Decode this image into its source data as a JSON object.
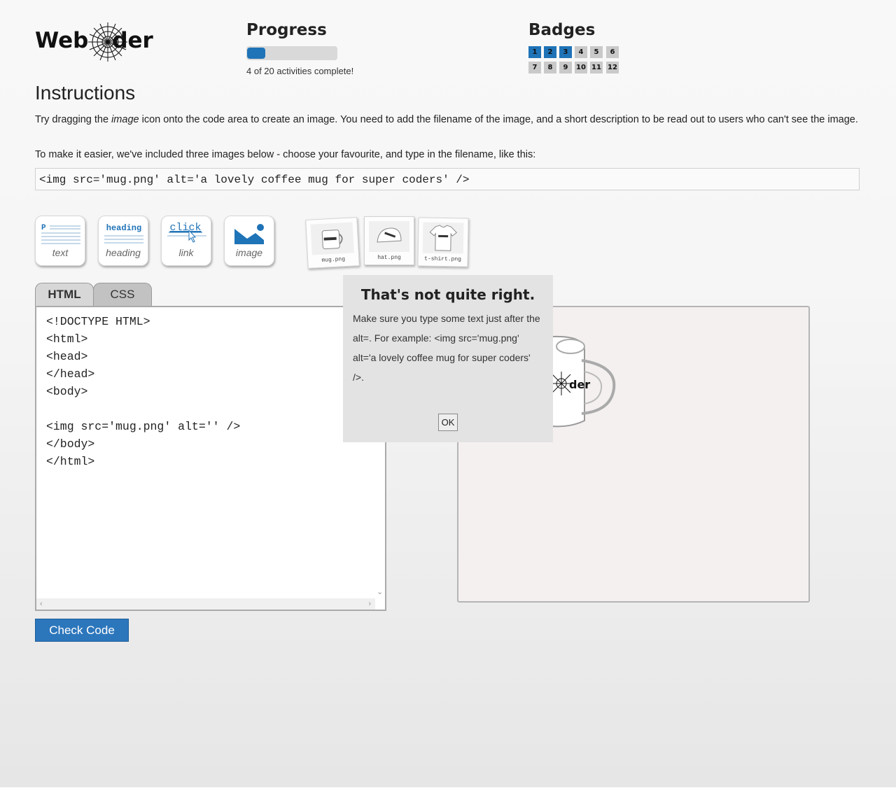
{
  "logo": {
    "text": "WebCoder",
    "text_prefix": "Web",
    "text_suffix": "der"
  },
  "progress": {
    "title": "Progress",
    "completed": 4,
    "total": 20,
    "fraction": 0.2,
    "status_text": "4 of 20 activities complete!"
  },
  "badges": {
    "title": "Badges",
    "items": [
      {
        "label": "1",
        "earned": true
      },
      {
        "label": "2",
        "earned": true
      },
      {
        "label": "3",
        "earned": true
      },
      {
        "label": "4",
        "earned": false
      },
      {
        "label": "5",
        "earned": false
      },
      {
        "label": "6",
        "earned": false
      },
      {
        "label": "7",
        "earned": false
      },
      {
        "label": "8",
        "earned": false
      },
      {
        "label": "9",
        "earned": false
      },
      {
        "label": "10",
        "earned": false
      },
      {
        "label": "11",
        "earned": false
      },
      {
        "label": "12",
        "earned": false
      }
    ]
  },
  "instructions": {
    "title": "Instructions",
    "p1_before": "Try dragging the ",
    "p1_em": "image",
    "p1_after": " icon onto the code area to create an image. You need to add the filename of the image, and a short description to be read out to users who can't see the image.",
    "p2": "To make it easier, we've included three images below - choose your favourite, and type in the filename, like this:",
    "example_code": "<img src='mug.png' alt='a lovely coffee mug for super coders' />"
  },
  "tools": [
    {
      "label": "text",
      "icon": "paragraph-icon",
      "icon_text": "P"
    },
    {
      "label": "heading",
      "icon": "heading-icon",
      "icon_text": "heading"
    },
    {
      "label": "link",
      "icon": "link-icon",
      "icon_text": "click"
    },
    {
      "label": "image",
      "icon": "image-icon"
    }
  ],
  "thumbnails": [
    {
      "label": "mug.png",
      "icon": "mug-icon"
    },
    {
      "label": "hat.png",
      "icon": "hat-icon"
    },
    {
      "label": "t-shirt.png",
      "icon": "tshirt-icon"
    }
  ],
  "tabs": {
    "html": "HTML",
    "css": "CSS",
    "active": "HTML"
  },
  "editor": {
    "code": "<!DOCTYPE HTML>\n<html>\n<head>\n</head>\n<body>\n\n<img src='mug.png' alt='' />\n</body>\n</html>"
  },
  "modal": {
    "title": "That's not quite right.",
    "body": "Make sure you type some text just after the alt=. For example: <img src='mug.png' alt='a lovely coffee mug for super coders' />.",
    "ok_label": "OK"
  },
  "check_button": {
    "label": "Check Code"
  },
  "colors": {
    "accent": "#1f73b7",
    "badge_locked": "#c9c9c9",
    "preview_bg": "#f5f0f0"
  }
}
